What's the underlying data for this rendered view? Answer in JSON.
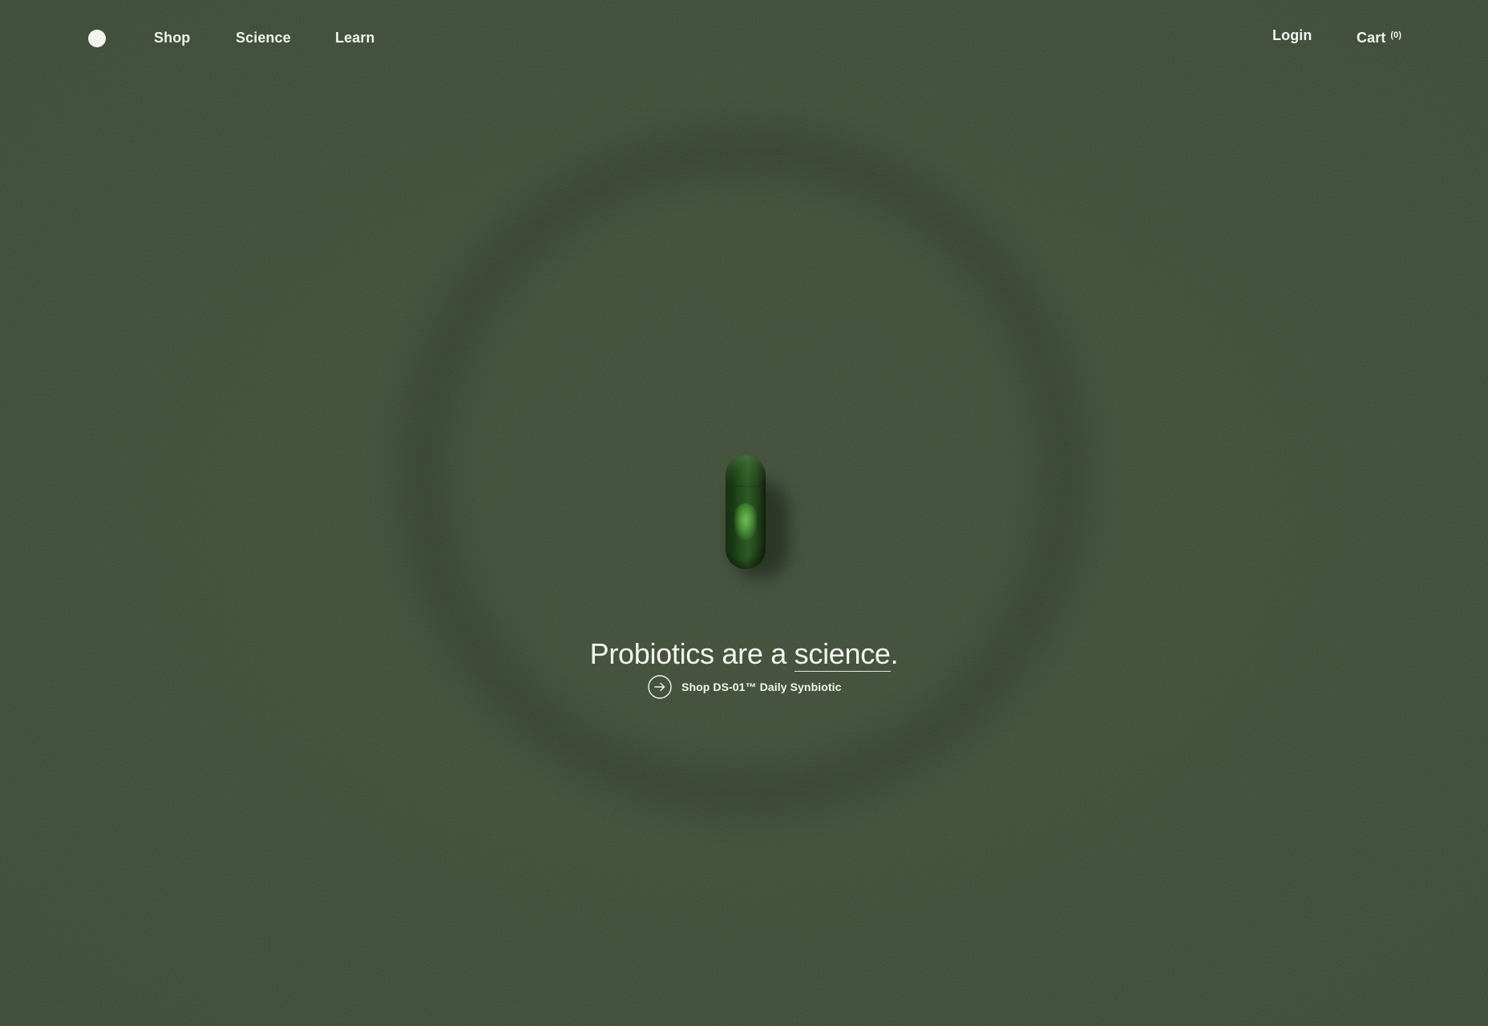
{
  "nav": {
    "logo_icon": "circle-logo-icon",
    "links": {
      "shop": "Shop",
      "science": "Science",
      "learn": "Learn"
    },
    "login": "Login",
    "cart": {
      "label": "Cart",
      "count": "(0)"
    }
  },
  "hero": {
    "headline_prefix": "Probiotics are a ",
    "headline_link": "science",
    "headline_suffix": ".",
    "cta": {
      "icon": "arrow-right-circle-icon",
      "label": "Shop DS-01™ Daily Synbiotic"
    },
    "image": "green-capsule"
  },
  "colors": {
    "background": "#3d4d33",
    "text": "#f3f4ef",
    "capsule": "#234a1c"
  }
}
